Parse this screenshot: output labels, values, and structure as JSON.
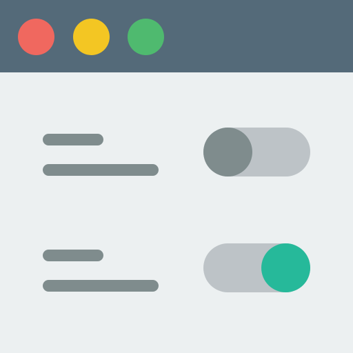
{
  "window": {
    "controls": {
      "close": {
        "icon": "close-dot-icon",
        "color": "#F0685F"
      },
      "minimize": {
        "icon": "minimize-dot-icon",
        "color": "#F3C623"
      },
      "zoom": {
        "icon": "zoom-dot-icon",
        "color": "#4FBA6F"
      }
    },
    "titlebar_color": "#546A79",
    "background": "#ECF0F1"
  },
  "settings": [
    {
      "label": "",
      "description": "",
      "enabled": false,
      "knob_color": "#7F8C8D",
      "track_color": "#BDC3C7"
    },
    {
      "label": "",
      "description": "",
      "enabled": true,
      "knob_color": "#26B99A",
      "track_color": "#BDC3C7"
    }
  ]
}
